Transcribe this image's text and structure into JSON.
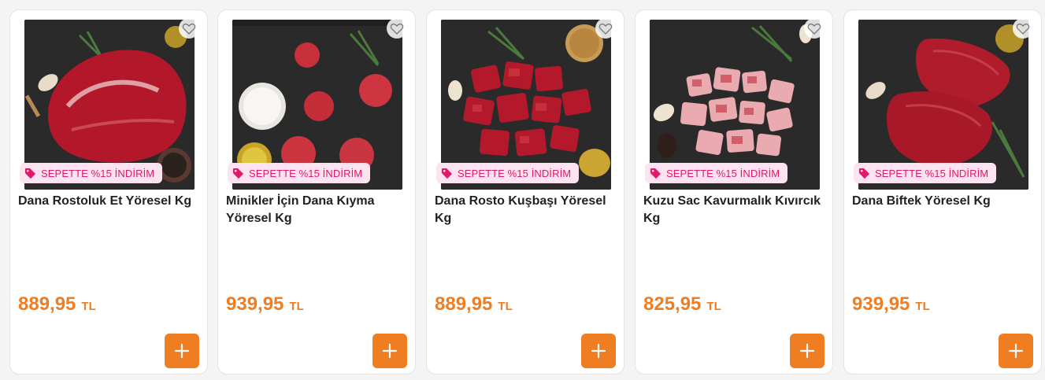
{
  "products": [
    {
      "badge": "SEPETTE %15 İNDİRİM",
      "title": "Dana Rostoluk Et Yöresel Kg",
      "price": "889,95",
      "currency": "TL",
      "image": "beef-roast-chunk"
    },
    {
      "badge": "SEPETTE %15 İNDİRİM",
      "title": "Minikler İçin Dana Kıyma Yöresel Kg",
      "price": "939,95",
      "currency": "TL",
      "image": "ground-beef-balls"
    },
    {
      "badge": "SEPETTE %15 İNDİRİM",
      "title": "Dana Rosto Kuşbaşı Yöresel Kg",
      "price": "889,95",
      "currency": "TL",
      "image": "beef-cubes"
    },
    {
      "badge": "SEPETTE %15 İNDİRİM",
      "title": "Kuzu Sac Kavurmalık Kıvırcık Kg",
      "price": "825,95",
      "currency": "TL",
      "image": "lamb-cubes"
    },
    {
      "badge": "SEPETTE %15 İNDİRİM",
      "title": "Dana Biftek Yöresel Kg",
      "price": "939,95",
      "currency": "TL",
      "image": "beef-steaks"
    }
  ],
  "colors": {
    "accent": "#ef7d22",
    "badge_text": "#e0196b",
    "badge_bg": "#fde3ef",
    "title": "#222222"
  },
  "icons": {
    "favorite": "heart-outline-icon",
    "badge": "tag-icon",
    "add": "plus-icon"
  }
}
